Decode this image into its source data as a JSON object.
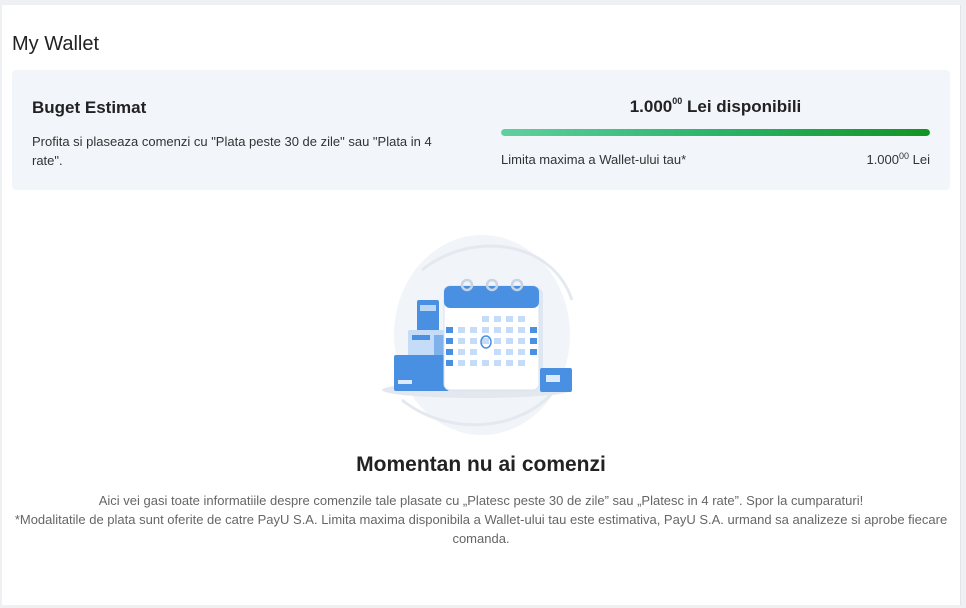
{
  "page": {
    "title": "My Wallet"
  },
  "budget": {
    "title": "Buget Estimat",
    "description": "Profita si plaseaza comenzi cu \"Plata peste 30 de zile\" sau \"Plata in 4 rate\".",
    "available_main": "1.000",
    "available_cents": "00",
    "available_suffix": " Lei disponibili",
    "available_fraction": 1.0,
    "limit_label": "Limita maxima a Wallet-ului tau*",
    "limit_main": "1.000",
    "limit_cents": "00",
    "limit_suffix": " Lei"
  },
  "empty_state": {
    "title": "Momentan nu ai comenzi",
    "line1": "Aici vei gasi toate informatiile despre comenzile tale plasate cu „Platesc peste 30 de zile” sau „Platesc in 4 rate”. Spor la cumparaturi!",
    "line2": "*Modalitatile de plata sunt oferite de catre PayU S.A. Limita maxima disponibila a Wallet-ului tau este estimativa, PayU S.A. urmand sa analizeze si aprobe fiecare comanda."
  },
  "colors": {
    "bar_start": "#5fd0a0",
    "bar_end": "#129423",
    "calendar_blue": "#4a90e2"
  }
}
